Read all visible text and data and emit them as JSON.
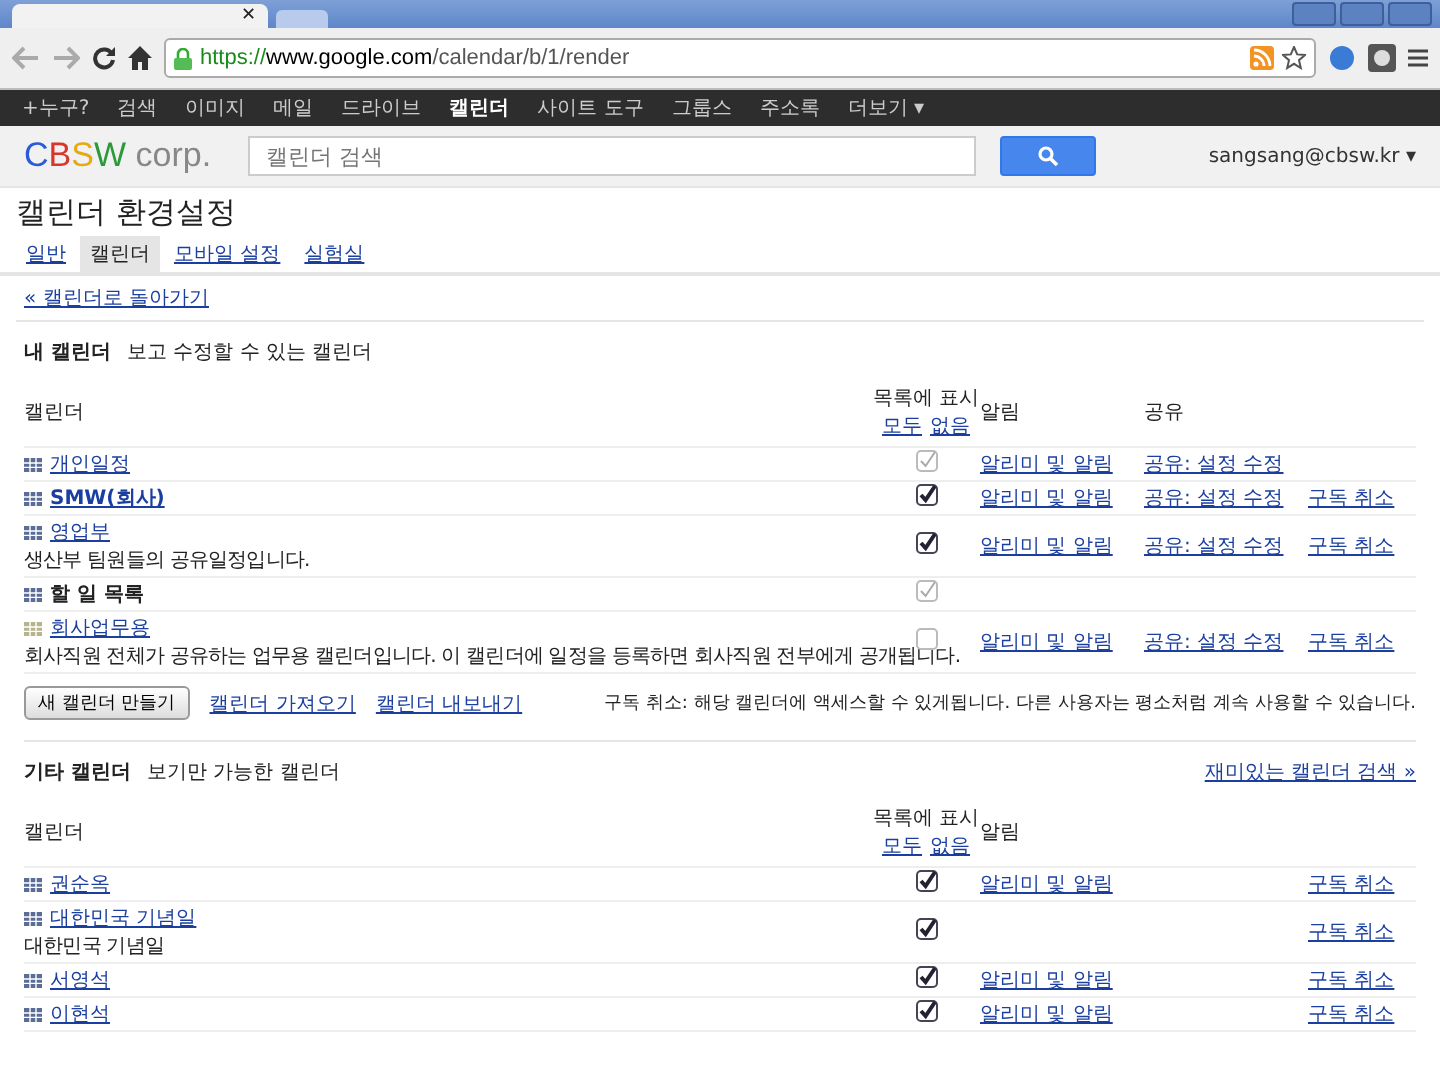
{
  "browser": {
    "tab_close": "✕",
    "url_scheme": "https://",
    "url_host": "www.google.com",
    "url_path": "/calendar/b/1/render"
  },
  "nav": [
    {
      "label": "+누구?",
      "selected": false
    },
    {
      "label": "검색",
      "selected": false
    },
    {
      "label": "이미지",
      "selected": false
    },
    {
      "label": "메일",
      "selected": false
    },
    {
      "label": "드라이브",
      "selected": false
    },
    {
      "label": "캘린더",
      "selected": true
    },
    {
      "label": "사이트 도구",
      "selected": false
    },
    {
      "label": "그룹스",
      "selected": false
    },
    {
      "label": "주소록",
      "selected": false
    },
    {
      "label": "더보기 ▾",
      "selected": false
    }
  ],
  "header": {
    "logo": [
      {
        "text": "C",
        "color": "#2a5bd7"
      },
      {
        "text": "B",
        "color": "#d9362b"
      },
      {
        "text": "S",
        "color": "#e8a812"
      },
      {
        "text": "W",
        "color": "#2d9a3a"
      }
    ],
    "logo_suffix": "corp.",
    "search": {
      "placeholder": "캘린더 검색"
    },
    "user": "sangsang@cbsw.kr ▾"
  },
  "page_title": "캘린더 환경설정",
  "tabs": [
    {
      "label": "일반",
      "selected": false
    },
    {
      "label": "캘린더",
      "selected": true
    },
    {
      "label": "모바일 설정",
      "selected": false
    },
    {
      "label": "실험실",
      "selected": false
    }
  ],
  "back_link": "« 캘린더로 돌아가기",
  "my_calendars": {
    "title": "내 캘린더",
    "subtitle": "보고 수정할 수 있는 캘린더",
    "columns": {
      "calendar": "캘린더",
      "show_in_list": "목록에 표시",
      "all": "모두",
      "none": "없음",
      "notifications": "알림",
      "sharing": "공유"
    },
    "rows": [
      {
        "name": "개인일정",
        "kind": "link",
        "bold": false,
        "color": "#5b6d96",
        "description": null,
        "checked": true,
        "disabled": true,
        "notify": "알리미 및 알림",
        "share": "공유: 설정 수정",
        "unsubscribe": null
      },
      {
        "name": "SMW(회사)",
        "kind": "link",
        "bold": true,
        "color": "#5b6d96",
        "description": null,
        "checked": true,
        "disabled": false,
        "notify": "알리미 및 알림",
        "share": "공유: 설정 수정",
        "unsubscribe": "구독 취소"
      },
      {
        "name": "영업부",
        "kind": "link",
        "bold": false,
        "color": "#5b6d96",
        "description": "생산부 팀원들의 공유일정입니다.",
        "checked": true,
        "disabled": false,
        "notify": "알리미 및 알림",
        "share": "공유: 설정 수정",
        "unsubscribe": "구독 취소"
      },
      {
        "name": "할 일 목록",
        "kind": "plain",
        "bold": true,
        "color": "#5b6d96",
        "description": null,
        "checked": true,
        "disabled": true,
        "notify": null,
        "share": null,
        "unsubscribe": null
      },
      {
        "name": "회사업무용",
        "kind": "link",
        "bold": false,
        "color": "#b8b48c",
        "description": "회사직원 전체가 공유하는 업무용 캘린더입니다. 이 캘린더에 일정을 등록하면 회사직원 전부에게 공개됩니다.",
        "checked": false,
        "disabled": true,
        "notify": "알리미 및 알림",
        "share": "공유: 설정 수정",
        "unsubscribe": "구독 취소"
      }
    ],
    "create_button": "새 캘린더 만들기",
    "import_link": "캘린더 가져오기",
    "export_link": "캘린더 내보내기",
    "note": "구독 취소: 해당 캘린더에 액세스할 수 있게됩니다. 다른 사용자는 평소처럼 계속 사용할 수 있습니다."
  },
  "other_calendars": {
    "title": "기타 캘린더",
    "subtitle": "보기만 가능한 캘린더",
    "browse_link": "재미있는 캘린더 검색 »",
    "columns": {
      "calendar": "캘린더",
      "show_in_list": "목록에 표시",
      "all": "모두",
      "none": "없음",
      "notifications": "알림"
    },
    "rows": [
      {
        "name": "권순옥",
        "kind": "link",
        "bold": false,
        "color": "#5b6d96",
        "description": null,
        "checked": true,
        "disabled": false,
        "notify": "알리미 및 알림",
        "unsubscribe": "구독 취소"
      },
      {
        "name": "대한민국 기념일",
        "kind": "link",
        "bold": false,
        "color": "#5b6d96",
        "description": "대한민국 기념일",
        "checked": true,
        "disabled": false,
        "notify": null,
        "unsubscribe": "구독 취소"
      },
      {
        "name": "서영석",
        "kind": "link",
        "bold": false,
        "color": "#5b6d96",
        "description": null,
        "checked": true,
        "disabled": false,
        "notify": "알리미 및 알림",
        "unsubscribe": "구독 취소"
      },
      {
        "name": "이현석",
        "kind": "link",
        "bold": false,
        "color": "#5b6d96",
        "description": null,
        "checked": true,
        "disabled": false,
        "notify": "알리미 및 알림",
        "unsubscribe": "구독 취소"
      }
    ]
  }
}
